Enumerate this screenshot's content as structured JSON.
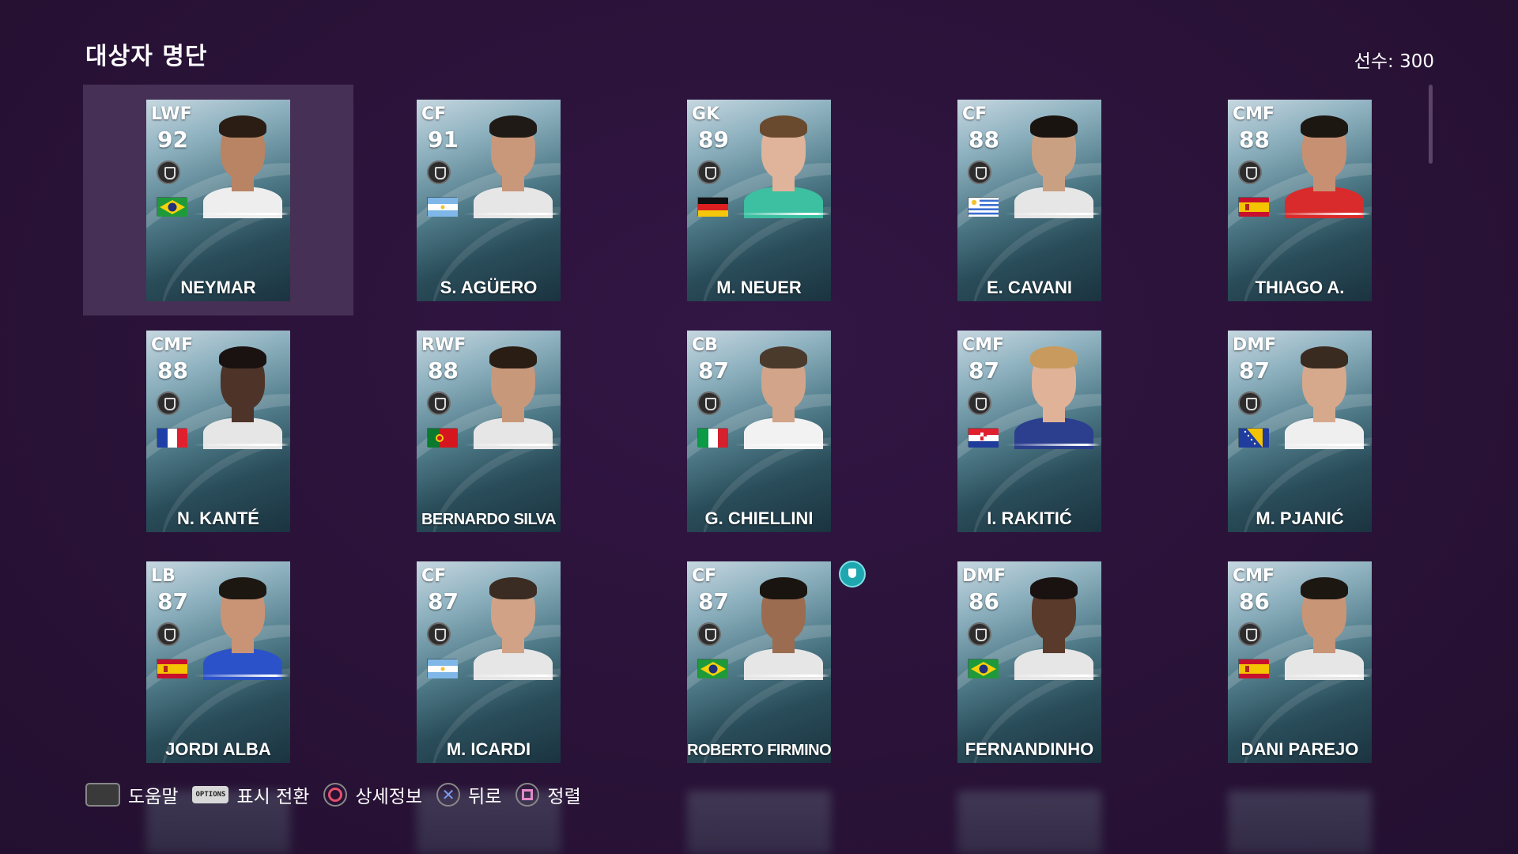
{
  "header": {
    "title": "대상자 명단",
    "player_count": "선수: 300"
  },
  "players": [
    {
      "pos": "LWF",
      "ovr": "92",
      "name": "NEYMAR",
      "flag": "brazil",
      "skin": "#b98463",
      "hair": "#2b1d14",
      "shirt": "#eeeeee",
      "selected": true
    },
    {
      "pos": "CF",
      "ovr": "91",
      "name": "S. AGÜERO",
      "flag": "argentina",
      "skin": "#c9977a",
      "hair": "#1f1a16",
      "shirt": "#e6e6e6"
    },
    {
      "pos": "GK",
      "ovr": "89",
      "name": "M. NEUER",
      "flag": "germany",
      "skin": "#e0b49a",
      "hair": "#6a4a2e",
      "shirt": "#3dbfa1"
    },
    {
      "pos": "CF",
      "ovr": "88",
      "name": "E. CAVANI",
      "flag": "uruguay",
      "skin": "#caa083",
      "hair": "#1a1410",
      "shirt": "#e6e6e6"
    },
    {
      "pos": "CMF",
      "ovr": "88",
      "name": "THIAGO A.",
      "flag": "spain",
      "skin": "#c79072",
      "hair": "#1d1712",
      "shirt": "#d92b2b"
    },
    {
      "pos": "CMF",
      "ovr": "88",
      "name": "N. KANTÉ",
      "flag": "france",
      "skin": "#4e3428",
      "hair": "#1a1210",
      "shirt": "#e6e6e6"
    },
    {
      "pos": "RWF",
      "ovr": "88",
      "name": "BERNARDO SILVA",
      "flag": "portugal",
      "skin": "#c8987a",
      "hair": "#2a1d14",
      "shirt": "#e6e6e6"
    },
    {
      "pos": "CB",
      "ovr": "87",
      "name": "G. CHIELLINI",
      "flag": "italy",
      "skin": "#d2a489",
      "hair": "#4a3a2c",
      "shirt": "#f2f2f2"
    },
    {
      "pos": "CMF",
      "ovr": "87",
      "name": "I. RAKITIĆ",
      "flag": "croatia",
      "skin": "#e0b298",
      "hair": "#c99a5e",
      "shirt": "#2b3f8e"
    },
    {
      "pos": "DMF",
      "ovr": "87",
      "name": "M. PJANIĆ",
      "flag": "bosnia",
      "skin": "#d6a98c",
      "hair": "#3a2b20",
      "shirt": "#efefef"
    },
    {
      "pos": "LB",
      "ovr": "87",
      "name": "JORDI ALBA",
      "flag": "spain",
      "skin": "#c89475",
      "hair": "#1d1712",
      "shirt": "#2c52c9"
    },
    {
      "pos": "CF",
      "ovr": "87",
      "name": "M. ICARDI",
      "flag": "argentina",
      "skin": "#d2a286",
      "hair": "#3a2c22",
      "shirt": "#e6e6e6"
    },
    {
      "pos": "CF",
      "ovr": "87",
      "name": "ROBERTO FIRMINO",
      "flag": "brazil",
      "skin": "#9c6c50",
      "hair": "#1a1410",
      "shirt": "#e6e6e6",
      "badge": true
    },
    {
      "pos": "DMF",
      "ovr": "86",
      "name": "FERNANDINHO",
      "flag": "brazil",
      "skin": "#5a3a2a",
      "hair": "#1a1210",
      "shirt": "#e6e6e6"
    },
    {
      "pos": "CMF",
      "ovr": "86",
      "name": "DANI PAREJO",
      "flag": "spain",
      "skin": "#c99577",
      "hair": "#1d1712",
      "shirt": "#e6e6e6"
    }
  ],
  "footer": {
    "help": "도움말",
    "options_icon_text": "OPTIONS",
    "toggle_display": "표시 전환",
    "details": "상세정보",
    "back": "뒤로",
    "sort": "정렬"
  },
  "colors": {
    "background": "#2a1238",
    "selected_cell": "#463056",
    "badge": "#1fa7b0"
  }
}
